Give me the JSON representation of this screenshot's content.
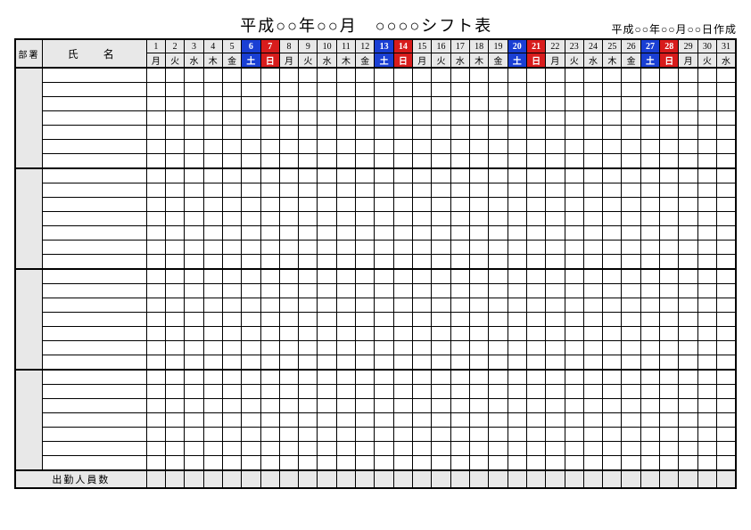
{
  "title": "平成○○年○○月　○○○○シフト表",
  "created_label": "平成○○年○○月○○日作成",
  "columns": {
    "dept": "部署",
    "name": "氏　名"
  },
  "days": [
    {
      "n": "1",
      "w": "月",
      "t": "plain"
    },
    {
      "n": "2",
      "w": "火",
      "t": "plain"
    },
    {
      "n": "3",
      "w": "水",
      "t": "plain"
    },
    {
      "n": "4",
      "w": "木",
      "t": "plain"
    },
    {
      "n": "5",
      "w": "金",
      "t": "plain"
    },
    {
      "n": "6",
      "w": "土",
      "t": "sat"
    },
    {
      "n": "7",
      "w": "日",
      "t": "sun"
    },
    {
      "n": "8",
      "w": "月",
      "t": "plain"
    },
    {
      "n": "9",
      "w": "火",
      "t": "plain"
    },
    {
      "n": "10",
      "w": "水",
      "t": "plain"
    },
    {
      "n": "11",
      "w": "木",
      "t": "plain"
    },
    {
      "n": "12",
      "w": "金",
      "t": "plain"
    },
    {
      "n": "13",
      "w": "土",
      "t": "sat"
    },
    {
      "n": "14",
      "w": "日",
      "t": "sun"
    },
    {
      "n": "15",
      "w": "月",
      "t": "plain"
    },
    {
      "n": "16",
      "w": "火",
      "t": "plain"
    },
    {
      "n": "17",
      "w": "水",
      "t": "plain"
    },
    {
      "n": "18",
      "w": "木",
      "t": "plain"
    },
    {
      "n": "19",
      "w": "金",
      "t": "plain"
    },
    {
      "n": "20",
      "w": "土",
      "t": "sat"
    },
    {
      "n": "21",
      "w": "日",
      "t": "sun"
    },
    {
      "n": "22",
      "w": "月",
      "t": "plain"
    },
    {
      "n": "23",
      "w": "火",
      "t": "plain"
    },
    {
      "n": "24",
      "w": "水",
      "t": "plain"
    },
    {
      "n": "25",
      "w": "木",
      "t": "plain"
    },
    {
      "n": "26",
      "w": "金",
      "t": "plain"
    },
    {
      "n": "27",
      "w": "土",
      "t": "sat"
    },
    {
      "n": "28",
      "w": "日",
      "t": "sun"
    },
    {
      "n": "29",
      "w": "月",
      "t": "plain"
    },
    {
      "n": "30",
      "w": "火",
      "t": "plain"
    },
    {
      "n": "31",
      "w": "水",
      "t": "plain"
    }
  ],
  "groups": 4,
  "rows_per_group": 7,
  "footer_label": "出勤人員数"
}
